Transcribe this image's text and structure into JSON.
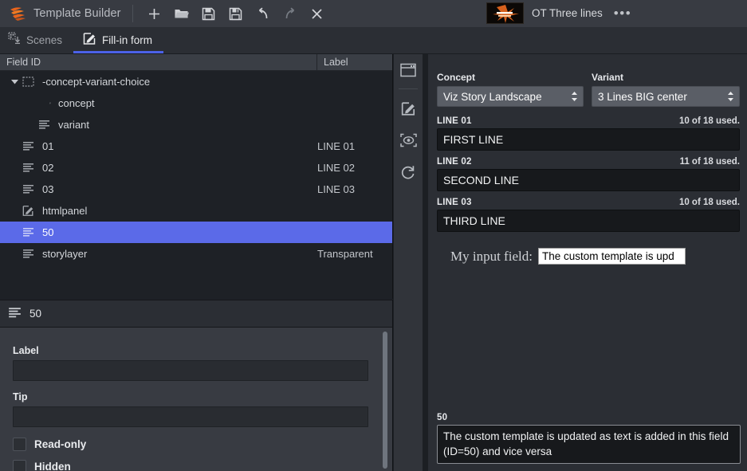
{
  "app": {
    "title": "Template Builder",
    "logo_icon": "viz-flame-logo"
  },
  "toolbar": {
    "buttons": [
      {
        "name": "new",
        "icon": "plus-icon",
        "enabled": true
      },
      {
        "name": "open",
        "icon": "folder-open-icon",
        "enabled": true
      },
      {
        "name": "save",
        "icon": "save-icon",
        "enabled": true
      },
      {
        "name": "save-as",
        "icon": "save-as-icon",
        "enabled": true
      },
      {
        "name": "undo",
        "icon": "undo-icon",
        "enabled": true
      },
      {
        "name": "redo",
        "icon": "redo-icon",
        "enabled": false
      },
      {
        "name": "close",
        "icon": "close-icon",
        "enabled": true
      }
    ]
  },
  "document": {
    "name": "OT Three lines",
    "more_label": "•••",
    "thumbnail_icon": "template-thumbnail"
  },
  "tabs": [
    {
      "label": "Scenes",
      "icon": "scenes-icon",
      "active": false
    },
    {
      "label": "Fill-in form",
      "icon": "fill-in-form-icon",
      "active": true
    }
  ],
  "tree": {
    "columns": {
      "field_id": "Field ID",
      "label": "Label"
    },
    "rows": [
      {
        "id": "-concept-variant-choice",
        "label": "",
        "icon": "group-icon",
        "indent": 0,
        "expanded": true,
        "selected": false
      },
      {
        "id": "concept",
        "label": "",
        "icon": "text-field-icon",
        "indent": 1,
        "selected": false
      },
      {
        "id": "variant",
        "label": "",
        "icon": "text-field-icon",
        "indent": 1,
        "selected": false
      },
      {
        "id": "01",
        "label": "LINE 01",
        "icon": "text-field-icon",
        "indent": 0,
        "selected": false
      },
      {
        "id": "02",
        "label": "LINE 02",
        "icon": "text-field-icon",
        "indent": 0,
        "selected": false
      },
      {
        "id": "03",
        "label": "LINE 03",
        "icon": "text-field-icon",
        "indent": 0,
        "selected": false
      },
      {
        "id": "htmlpanel",
        "label": "",
        "icon": "html-panel-icon",
        "indent": 0,
        "selected": false
      },
      {
        "id": "50",
        "label": "",
        "icon": "text-field-icon",
        "indent": 0,
        "selected": true
      },
      {
        "id": "storylayer",
        "label": "Transparent",
        "icon": "text-field-icon",
        "indent": 0,
        "selected": false
      }
    ]
  },
  "properties": {
    "header_title": "50",
    "header_icon": "text-field-icon",
    "label_caption": "Label",
    "label_value": "",
    "tip_caption": "Tip",
    "tip_value": "",
    "readonly_caption": "Read-only",
    "readonly_checked": false,
    "hidden_caption": "Hidden",
    "hidden_checked": false
  },
  "rail": {
    "buttons": [
      {
        "name": "panel",
        "icon": "window-panel-icon"
      },
      {
        "name": "edit",
        "icon": "edit-pencil-icon"
      },
      {
        "name": "preview",
        "icon": "eye-preview-icon"
      },
      {
        "name": "refresh",
        "icon": "refresh-icon"
      }
    ]
  },
  "form": {
    "concept": {
      "caption": "Concept",
      "value": "Viz Story Landscape",
      "spinner_icon": "spinner-updown-icon"
    },
    "variant": {
      "caption": "Variant",
      "value": "3 Lines BIG center",
      "spinner_icon": "spinner-updown-icon"
    },
    "fields": [
      {
        "caption": "LINE 01",
        "counter": "10 of 18 used.",
        "value": "FIRST LINE"
      },
      {
        "caption": "LINE 02",
        "counter": "11 of 18 used.",
        "value": "SECOND LINE"
      },
      {
        "caption": "LINE 03",
        "counter": "10 of 18 used.",
        "value": "THIRD LINE"
      }
    ],
    "html_panel": {
      "prompt": "My input field:",
      "input_value": "The custom template is upd"
    },
    "field_50": {
      "caption": "50",
      "value": "The custom template is updated as text is added in this field (ID=50) and vice versa"
    }
  },
  "colors": {
    "accent": "#4c62e8",
    "selection": "#5b6ae8",
    "brand_orange": "#e8641c",
    "panel_bg": "#2b2e34",
    "tree_bg": "#1e2126",
    "input_bg": "#17191c"
  }
}
